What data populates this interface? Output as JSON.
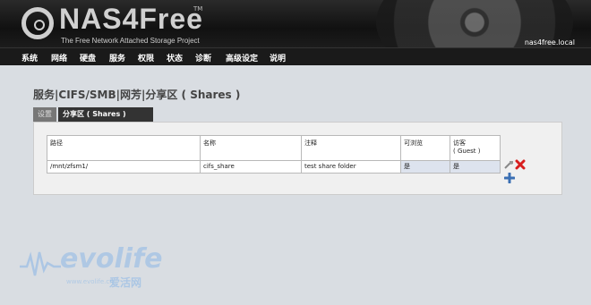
{
  "header": {
    "logo_text": "NAS4Free",
    "logo_tm": "TM",
    "tagline": "The Free Network Attached Storage Project",
    "hostname": "nas4free.local"
  },
  "menu": [
    "系统",
    "网络",
    "硬盘",
    "服务",
    "权限",
    "状态",
    "诊断",
    "高级设定",
    "说明"
  ],
  "page": {
    "title": "服务|CIFS/SMB|网芳|分享区 ( Shares )"
  },
  "tabs": {
    "settings": "设置",
    "shares": "分享区 ( Shares )"
  },
  "table": {
    "headers": {
      "path": "路径",
      "name": "名称",
      "comment": "注释",
      "browseable": "可浏览",
      "guest_line1": "访客",
      "guest_line2": "( Guest )"
    },
    "rows": [
      {
        "path": "/mnt/zfsm1/",
        "name": "cifs_share",
        "comment": "test share folder",
        "browseable": "是",
        "guest": "是"
      }
    ]
  },
  "icons": {
    "edit": "edit-icon",
    "delete": "delete-icon",
    "add": "add-icon"
  },
  "watermark": {
    "brand": "evolife",
    "url": "www.evolife.cn",
    "cn": "爱活网"
  },
  "colors": {
    "header_bg": "#111111",
    "menubar_bg": "#1a1a1a",
    "page_bg": "#d9dde2",
    "delete_red": "#d81e1e",
    "add_blue": "#3b6fb3"
  }
}
